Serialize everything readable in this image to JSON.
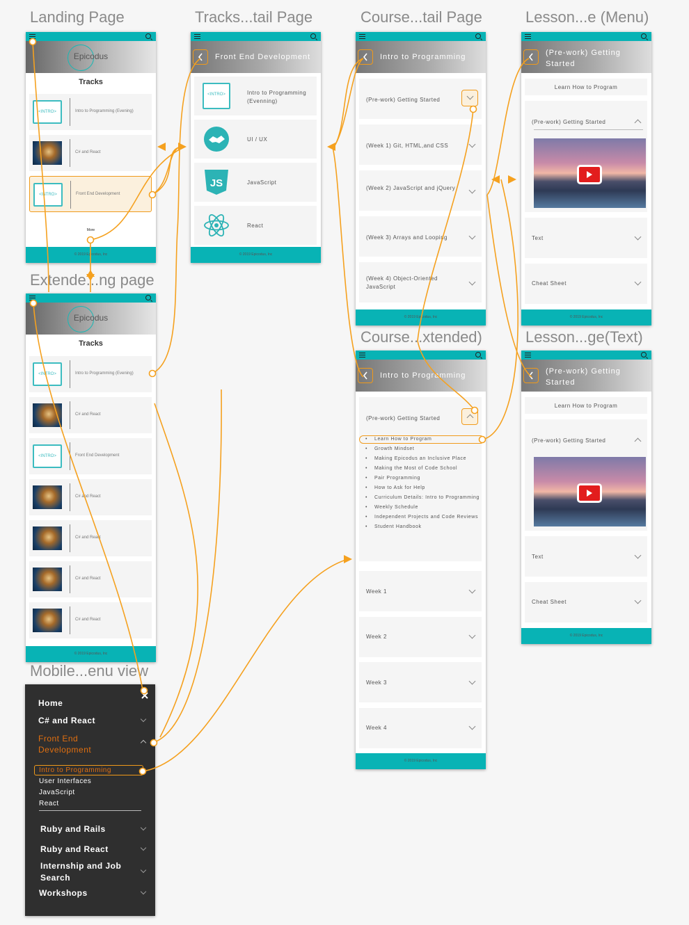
{
  "artboard_titles": {
    "landing": "Landing Page",
    "tracks_detail": "Tracks...tail Page",
    "course_detail": "Course...tail Page",
    "lesson_menu": "Lesson...e (Menu)",
    "extended_landing": "Extende...ng page",
    "course_extended": "Course...xtended)",
    "lesson_text": "Lesson...ge(Text)",
    "mobile_menu": "Mobile...enu view"
  },
  "brand": {
    "logo": "Epicodus",
    "footer": "© 2019 Epicodus, Inc"
  },
  "landing": {
    "heading": "Tracks",
    "tracks": [
      {
        "label": "Intro to Programming (Evening)",
        "thumb": "intro-folder-icon",
        "thumb_text": "<INTRO>"
      },
      {
        "label": "C# and React",
        "thumb": "photo"
      },
      {
        "label": "Front End Development",
        "thumb": "intro-folder-icon",
        "thumb_text": "<INTRO>"
      }
    ],
    "more": "More"
  },
  "extended": {
    "heading": "Tracks",
    "tracks": [
      {
        "label": "Intro to Programming (Evening)",
        "thumb": "intro-folder-icon",
        "thumb_text": "<INTRO>"
      },
      {
        "label": "C# and React",
        "thumb": "photo"
      },
      {
        "label": "Front End Development",
        "thumb": "intro-folder-icon",
        "thumb_text": "<INTRO>"
      },
      {
        "label": "C# and React",
        "thumb": "photo"
      },
      {
        "label": "C# and React",
        "thumb": "photo"
      },
      {
        "label": "C# and React",
        "thumb": "photo"
      },
      {
        "label": "C# and React",
        "thumb": "photo"
      }
    ]
  },
  "tracks_detail": {
    "title": "Front End Development",
    "courses": [
      {
        "label": "Intro to Programming (Evenning)",
        "icon": "intro-folder-icon",
        "icon_text": "<INTRO>"
      },
      {
        "label": "UI / UX",
        "icon": "handshake-icon"
      },
      {
        "label": "JavaScript",
        "icon": "js-shield-icon",
        "icon_text": "JS"
      },
      {
        "label": "React",
        "icon": "react-atom-icon"
      }
    ]
  },
  "course_detail": {
    "title": "Intro to Programming",
    "weeks": [
      "(Pre-work) Getting Started",
      "(Week 1) Git, HTML,and CSS",
      "(Week 2) JavaScript and jQuery",
      "(Week 3) Arrays and Looping",
      "(Week 4) Object-Oriented JavaScript"
    ]
  },
  "course_extended": {
    "title": "Intro to Programming",
    "open_section": "(Pre-work) Getting Started",
    "lessons": [
      "Learn How to Program",
      "Growth Mindset",
      "Making Epicodus an Inclusive Place",
      "Making the Most of Code School",
      "Pair Programming",
      "How to Ask for Help",
      "Curriculum Details: Intro to Programming",
      "Weekly Schedule",
      "Independent Projects and Code Reviews",
      "Student Handbook"
    ],
    "weeks": [
      "Week 1",
      "Week 2",
      "Week 3",
      "Week 4"
    ]
  },
  "lesson": {
    "title": "(Pre-work) Getting Started",
    "subtitle": "Learn How to Program",
    "section": "(Pre-work) Getting Started",
    "text": "Text",
    "cheat_sheet": "Cheat Sheet"
  },
  "mobile_menu": {
    "items": [
      {
        "label": "Home"
      },
      {
        "label": "C# and React"
      },
      {
        "label": "Front End Development",
        "active": true
      },
      {
        "label": "Ruby and Rails"
      },
      {
        "label": "Ruby and React"
      },
      {
        "label": "Internship and Job Search"
      },
      {
        "label": "Workshops"
      }
    ],
    "sub_items": [
      "Intro to Programming",
      "User Interfaces",
      "JavaScript",
      "React"
    ]
  },
  "colors": {
    "teal": "#08b3b5",
    "orange": "#f09a1a",
    "menu_active": "#e06f10",
    "menu_bg": "#2f2f2f"
  }
}
